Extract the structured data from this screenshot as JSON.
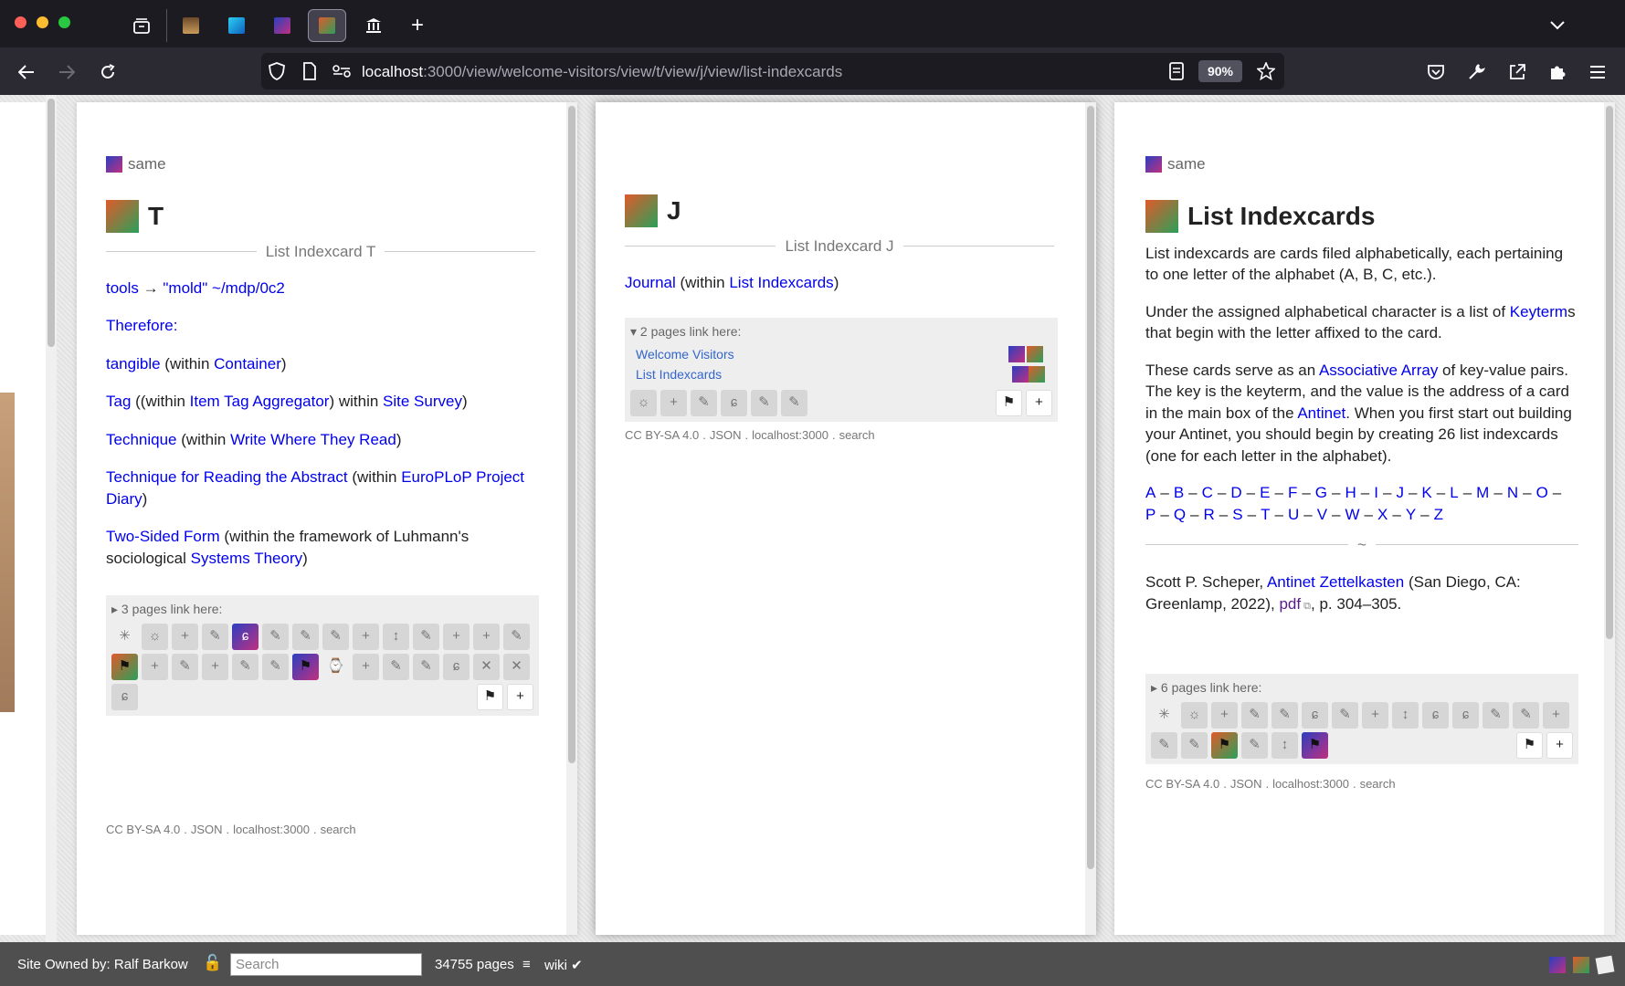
{
  "browser": {
    "url_host": "localhost",
    "url_path": ":3000/view/welcome-visitors/view/t/view/j/view/list-indexcards",
    "zoom": "90%",
    "tabs": [
      {
        "name": "tab-bookmarks-icon",
        "color": "#888"
      },
      {
        "name": "tab-book-icon",
        "color": "#8a6b4a"
      },
      {
        "name": "tab-cyan-icon",
        "color": "#1e9bd7"
      },
      {
        "name": "tab-purple-icon",
        "color": "#7a3fb0"
      },
      {
        "name": "tab-wiki-icon",
        "color": "#3a9a5a"
      },
      {
        "name": "tab-museum-icon",
        "color": "#fff"
      }
    ]
  },
  "pages": {
    "t": {
      "site_label": "same",
      "title": "T",
      "divider": "List Indexcard T",
      "lines": {
        "l1_a": "tools",
        "l1_b": " → ",
        "l1_c": "\"mold\" ~/mdp/0c2",
        "l2": "Therefore:",
        "l3_a": "tangible",
        "l3_b": " (within ",
        "l3_c": "Container",
        "l3_d": ")",
        "l4_a": "Tag",
        "l4_b": " ((within ",
        "l4_c": "Item Tag Aggregator",
        "l4_d": ") within ",
        "l4_e": "Site Survey",
        "l4_f": ")",
        "l5_a": "Technique",
        "l5_b": " (within ",
        "l5_c": "Write Where They Read",
        "l5_d": ")",
        "l6_a": "Technique for Reading the Abstract",
        "l6_b": " (within ",
        "l6_c": "EuroPLoP Project Diary",
        "l6_d": ")",
        "l7_a": "Two-Sided Form",
        "l7_b": " (within the framework of Luhmann's sociological ",
        "l7_c": "Systems Theory",
        "l7_d": ")"
      },
      "refs_header": "▸ 3 pages link here:",
      "footer": [
        "CC BY-SA 4.0",
        ".",
        "JSON",
        ".",
        "localhost:3000",
        ".",
        "search"
      ]
    },
    "j": {
      "title": "J",
      "divider": "List Indexcard J",
      "line_a": "Journal",
      "line_b": " (within ",
      "line_c": "List Indexcards",
      "line_d": ")",
      "refs_header": "▾ 2 pages link here:",
      "refs": [
        "Welcome Visitors",
        "List Indexcards"
      ],
      "footer": [
        "CC BY-SA 4.0",
        ".",
        "JSON",
        ".",
        "localhost:3000",
        ".",
        "search"
      ]
    },
    "list": {
      "site_label": "same",
      "title": "List Indexcards",
      "p1": "List indexcards are cards filed alphabetically, each pertaining to one letter of the alphabet (A, B, C, etc.).",
      "p2_a": "Under the assigned alphabetical character is a list of ",
      "p2_b": "Keyterm",
      "p2_c": "s that begin with the letter affixed to the card.",
      "p3_a": "These cards serve as an ",
      "p3_b": "Associative Array",
      "p3_c": " of key-value pairs. The key is the keyterm, and the value is the address of a card in the main box of the ",
      "p3_d": "Antinet",
      "p3_e": ". When you first start out building your Antinet, you should begin by creating 26 list indexcards (one for each letter in the alphabet).",
      "letters": [
        "A",
        "B",
        "C",
        "D",
        "E",
        "F",
        "G",
        "H",
        "I",
        "J",
        "K",
        "L",
        "M",
        "N",
        "O",
        "P",
        "Q",
        "R",
        "S",
        "T",
        "U",
        "V",
        "W",
        "X",
        "Y",
        "Z"
      ],
      "sep": "–",
      "tilde": "~",
      "cite_a": "Scott P. Scheper, ",
      "cite_b": "Antinet Zettelkasten",
      "cite_c": " (San Diego, CA: Greenlamp, 2022), ",
      "cite_d": "pdf",
      "cite_e": ", p. 304–305.",
      "refs_header": "▸ 6 pages link here:",
      "footer": [
        "CC BY-SA 4.0",
        ".",
        "JSON",
        ".",
        "localhost:3000",
        ".",
        "search"
      ]
    }
  },
  "status": {
    "owner": "Site Owned by: Ralf Barkow",
    "search_placeholder": "Search",
    "pages": "34755 pages",
    "menu": "≡",
    "wiki": "wiki ✔"
  }
}
